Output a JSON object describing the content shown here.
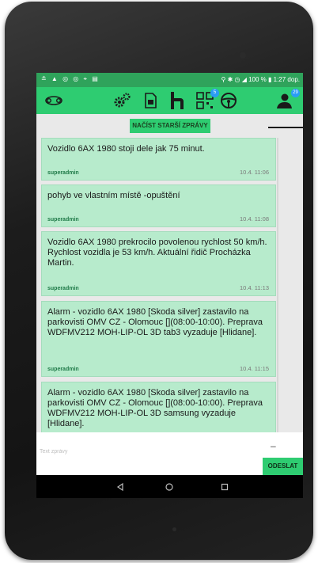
{
  "status_bar": {
    "left_icons": "≗ ▲ ◎ ◎ ⌖ ▤",
    "right_text": "100 % ▮ 1:27 dop."
  },
  "toolbar": {
    "icons": [
      "car-icon",
      "settings-gears-icon",
      "sim-card-icon",
      "phone-with-u-icon",
      "qr-code-icon",
      "steering-wheel-icon",
      "user-icon"
    ],
    "qr_badge": "5",
    "user_badge": "29"
  },
  "load_older_label": "NAČÍST STARŠÍ ZPRÁVY",
  "messages": [
    {
      "text": "Vozidlo 6AX 1980 stoji dele jak 75 minut.",
      "user": "superadmin",
      "time": "10.4. 11:06"
    },
    {
      "text": "pohyb ve vlastním místě -opuštění",
      "user": "superadmin",
      "time": "10.4. 11:08"
    },
    {
      "text": "Vozidlo 6AX 1980 prekrocilo povolenou rychlost 50 km/h. Rychlost vozidla je 53 km/h. Aktuální řidič Procházka Martin.",
      "user": "superadmin",
      "time": "10.4. 11:13"
    },
    {
      "text": "Alarm - vozidlo 6AX 1980 [Skoda silver] zastavilo na parkovisti OMV CZ - Olomouc [](08:00-10:00). Preprava WDFMV212 MOH-LIP-OL 3D tab3 vyzaduje [Hlidane].",
      "user": "superadmin",
      "time": "10.4. 11:15"
    },
    {
      "text": "Alarm - vozidlo 6AX 1980 [Skoda silver] zastavilo na parkovisti OMV CZ - Olomouc [](08:00-10:00). Preprava WDFMV212 MOH-LIP-OL 3D samsung vyzaduje [Hlidane].",
      "user": "",
      "time": ""
    }
  ],
  "compose": {
    "placeholder": "Text zprávy",
    "minus_label": "–",
    "send_label": "ODESLAT"
  },
  "nav": {
    "back": "◁",
    "home": "○",
    "recents": "□"
  },
  "colors": {
    "accent": "#2ecc71",
    "status_bar": "#2fa35b",
    "message_bg": "#b7ebcc",
    "user_text": "#1f7a48"
  }
}
